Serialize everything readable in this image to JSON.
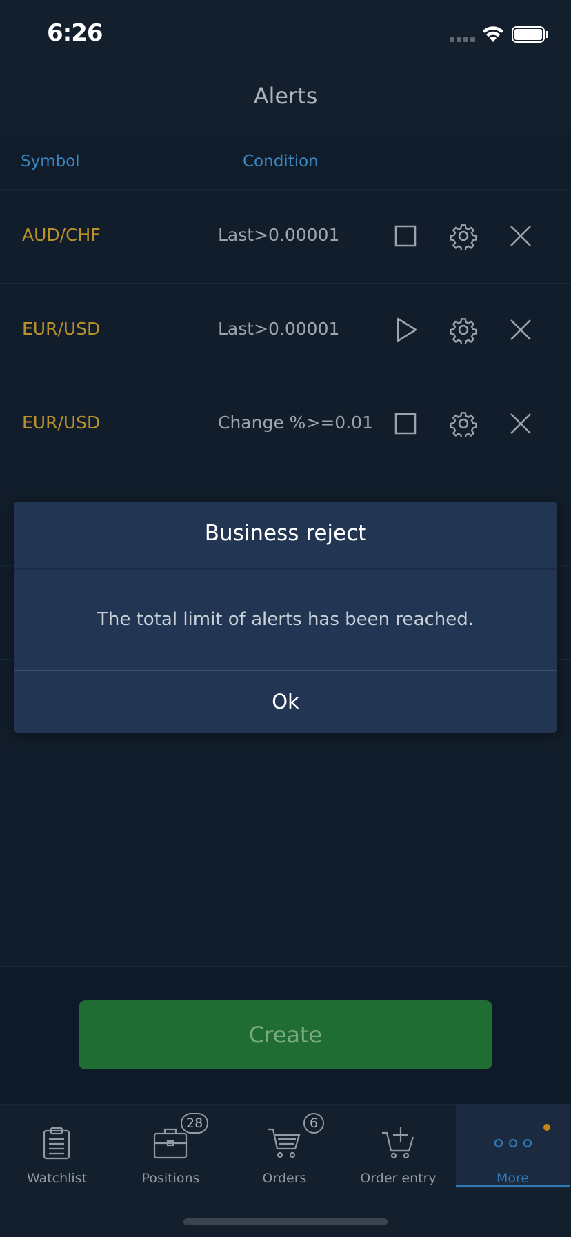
{
  "status_bar": {
    "time": "6:26"
  },
  "header": {
    "title": "Alerts"
  },
  "columns": {
    "symbol": "Symbol",
    "condition": "Condition"
  },
  "alerts": [
    {
      "symbol": "AUD/CHF",
      "condition": "Last>0.00001",
      "state_icon": "stop-square-icon"
    },
    {
      "symbol": "EUR/USD",
      "condition": "Last>0.00001",
      "state_icon": "play-icon"
    },
    {
      "symbol": "EUR/USD",
      "condition": "Change %>=0.01",
      "state_icon": "stop-square-icon"
    }
  ],
  "dialog": {
    "title": "Business reject",
    "message": "The total limit of alerts has been reached.",
    "ok_label": "Ok"
  },
  "create_button": {
    "label": "Create"
  },
  "tab_bar": {
    "tabs": [
      {
        "label": "Watchlist",
        "icon": "clipboard-icon"
      },
      {
        "label": "Positions",
        "icon": "briefcase-icon",
        "badge": "28"
      },
      {
        "label": "Orders",
        "icon": "cart-icon",
        "badge": "6"
      },
      {
        "label": "Order entry",
        "icon": "cart-plus-icon"
      },
      {
        "label": "More",
        "icon": "more-dots-icon",
        "active": true
      }
    ]
  },
  "colors": {
    "background": "#121d2b",
    "symbol_gold": "#b8912b",
    "column_blue": "#3a88bf",
    "dialog_bg": "#223653",
    "create_green": "#1f6d32",
    "active_tab_underline": "#2d78b5",
    "notification_dot": "#c8860e"
  }
}
